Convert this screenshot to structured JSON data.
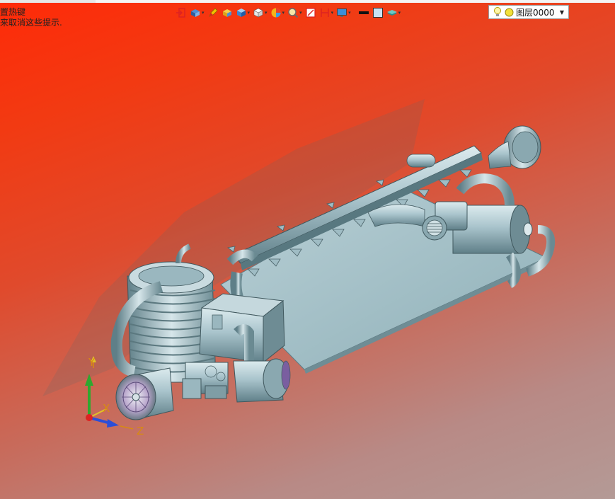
{
  "hint": {
    "line1": "置热键",
    "line2": "来取消这些提示."
  },
  "toolbar": {
    "items": [
      {
        "name": "exit-sketch-icon",
        "dropdown": false
      },
      {
        "name": "view-orient-icon",
        "dropdown": true
      },
      {
        "name": "pen-icon",
        "dropdown": false
      },
      {
        "name": "shaded-box-icon",
        "dropdown": false
      },
      {
        "name": "cube-blue-icon",
        "dropdown": true
      },
      {
        "name": "cube-white-icon",
        "dropdown": true
      },
      {
        "name": "sphere-color-icon",
        "dropdown": true
      },
      {
        "name": "zoom-icon",
        "dropdown": true
      },
      {
        "name": "section-icon",
        "dropdown": false
      },
      {
        "name": "clip-plane-icon",
        "dropdown": true
      },
      {
        "name": "display-monitor-icon",
        "dropdown": true
      },
      {
        "name": "line-color-icon",
        "dropdown": false
      },
      {
        "name": "background-color-icon",
        "dropdown": false
      },
      {
        "name": "layer-stack-icon",
        "dropdown": true
      }
    ]
  },
  "layer": {
    "value": "图层0000"
  },
  "triad": {
    "y_label": "Y",
    "x_label": "X",
    "z_label": "Z"
  },
  "colors": {
    "background_top": "#ff2a08",
    "background_bottom": "#b49a96",
    "model": "#a9c4cc",
    "axis_label": "#d88a12"
  }
}
